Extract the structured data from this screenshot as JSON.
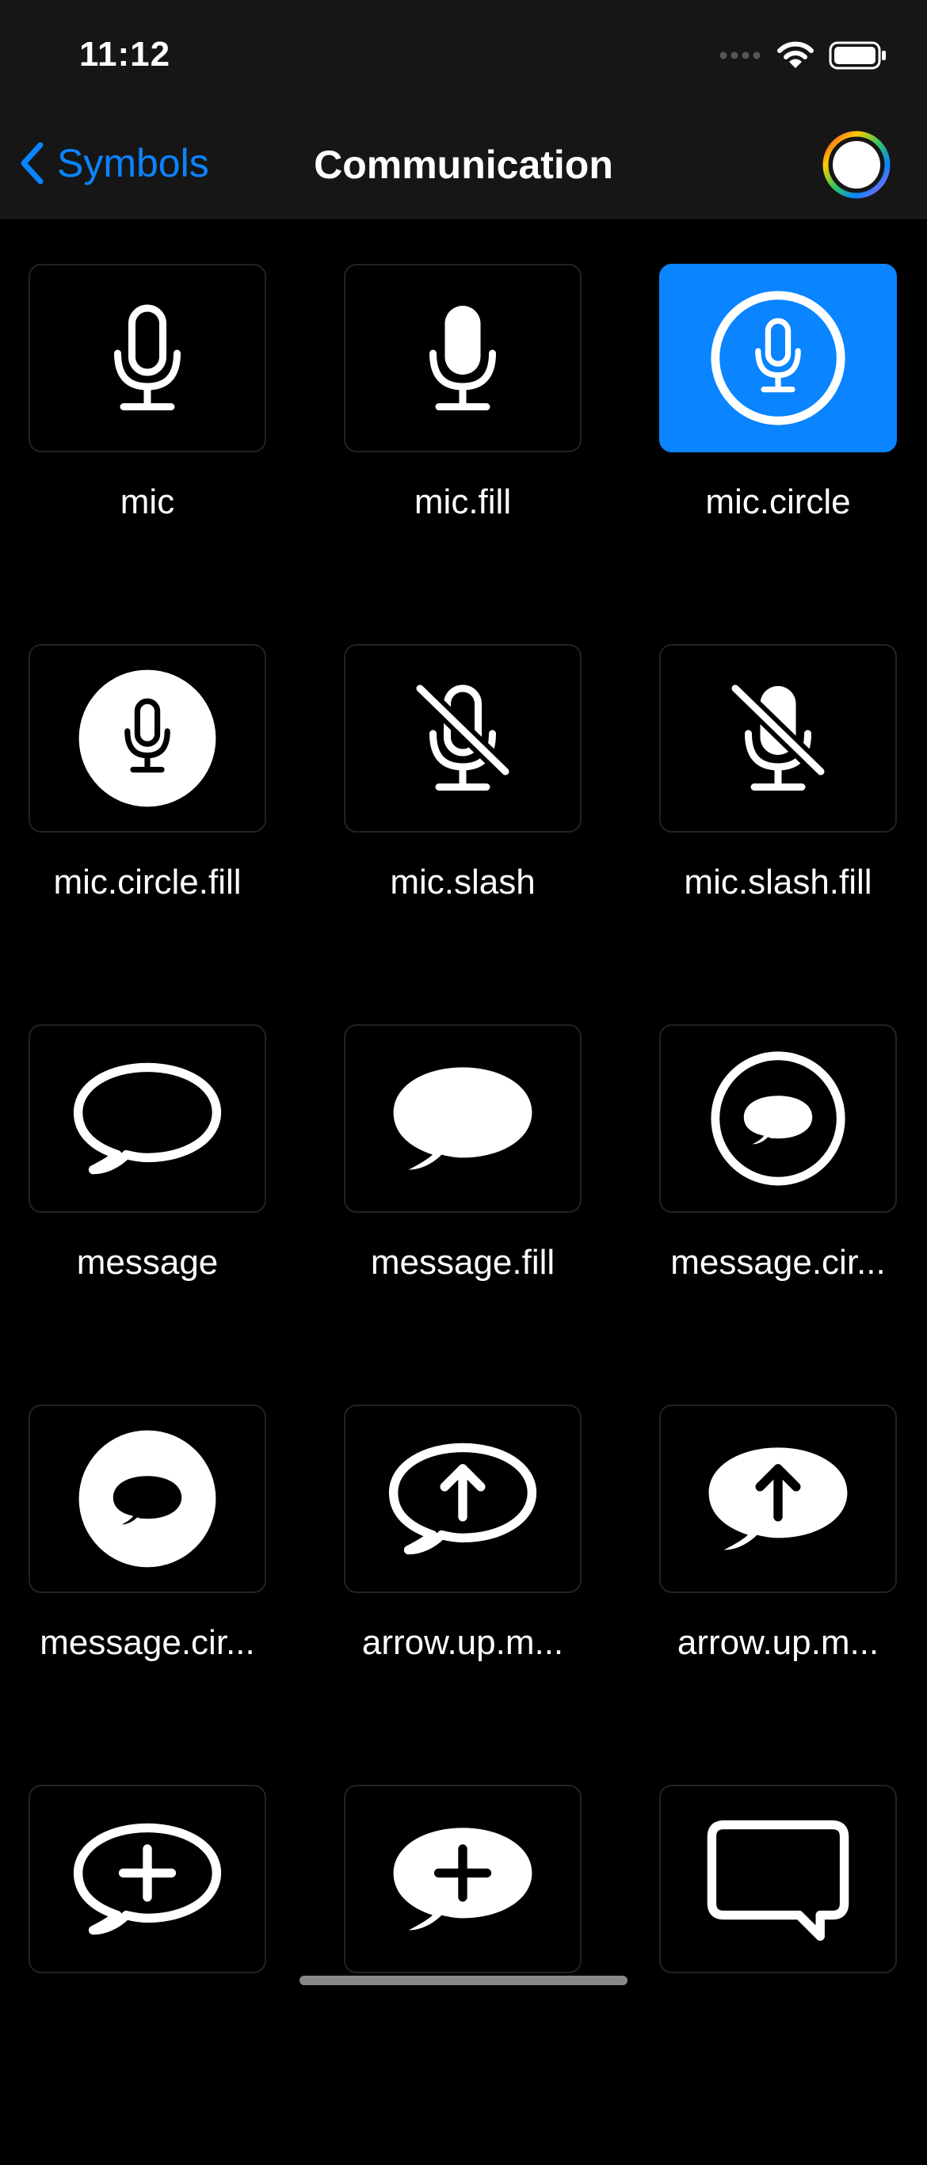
{
  "status_bar": {
    "time": "11:12"
  },
  "nav": {
    "back_label": "Symbols",
    "title": "Communication"
  },
  "colors": {
    "accent": "#0a84ff",
    "background": "#000000",
    "bar": "#161616"
  },
  "symbols": [
    {
      "label": "mic",
      "icon": "mic-icon",
      "selected": false
    },
    {
      "label": "mic.fill",
      "icon": "mic-fill-icon",
      "selected": false
    },
    {
      "label": "mic.circle",
      "icon": "mic-circle-icon",
      "selected": true
    },
    {
      "label": "mic.circle.fill",
      "icon": "mic-circle-fill-icon",
      "selected": false
    },
    {
      "label": "mic.slash",
      "icon": "mic-slash-icon",
      "selected": false
    },
    {
      "label": "mic.slash.fill",
      "icon": "mic-slash-fill-icon",
      "selected": false
    },
    {
      "label": "message",
      "icon": "message-icon",
      "selected": false
    },
    {
      "label": "message.fill",
      "icon": "message-fill-icon",
      "selected": false
    },
    {
      "label": "message.cir...",
      "icon": "message-circle-icon",
      "selected": false
    },
    {
      "label": "message.cir...",
      "icon": "message-circle-fill-icon",
      "selected": false
    },
    {
      "label": "arrow.up.m...",
      "icon": "arrow-up-message-icon",
      "selected": false
    },
    {
      "label": "arrow.up.m...",
      "icon": "arrow-up-message-fill-icon",
      "selected": false
    },
    {
      "label": "",
      "icon": "plus-message-icon",
      "selected": false
    },
    {
      "label": "",
      "icon": "plus-message-fill-icon",
      "selected": false
    },
    {
      "label": "",
      "icon": "square-bubble-icon",
      "selected": false
    }
  ]
}
